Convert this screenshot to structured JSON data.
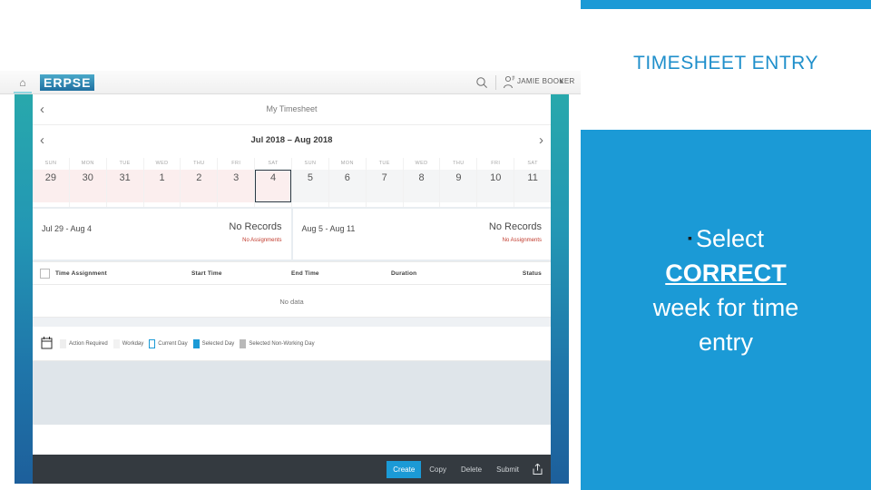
{
  "slide": {
    "title": "TIMESHEET ENTRY",
    "bullet": {
      "marker": "▪",
      "line1": "Select",
      "emphasis": "CORRECT",
      "line2": "week for time",
      "line3": "entry"
    },
    "colors": {
      "accent_blue": "#1b9ad6",
      "title_blue": "#1f8fcb",
      "panel_white": "#ffffff"
    }
  },
  "app": {
    "header": {
      "home_icon": "home-icon",
      "brand": "ERPSE",
      "search_icon": "search-icon",
      "user_icon": "user-icon",
      "user_name": "JAMIE BOOKER",
      "caret": "∨"
    },
    "nav": {
      "back_chevron": "‹",
      "forward_chevron": "›",
      "page_title": "My Timesheet",
      "period": "Jul 2018 – Aug 2018"
    },
    "calendar": {
      "days": [
        {
          "dow": "SUN",
          "num": "29",
          "week": "a",
          "selected": false
        },
        {
          "dow": "MON",
          "num": "30",
          "week": "a",
          "selected": false
        },
        {
          "dow": "TUE",
          "num": "31",
          "week": "a",
          "selected": false
        },
        {
          "dow": "WED",
          "num": "1",
          "week": "a",
          "selected": false
        },
        {
          "dow": "THU",
          "num": "2",
          "week": "a",
          "selected": false
        },
        {
          "dow": "FRI",
          "num": "3",
          "week": "a",
          "selected": false
        },
        {
          "dow": "SAT",
          "num": "4",
          "week": "a",
          "selected": true
        },
        {
          "dow": "SUN",
          "num": "5",
          "week": "b",
          "selected": false
        },
        {
          "dow": "MON",
          "num": "6",
          "week": "b",
          "selected": false
        },
        {
          "dow": "TUE",
          "num": "7",
          "week": "b",
          "selected": false
        },
        {
          "dow": "WED",
          "num": "8",
          "week": "b",
          "selected": false
        },
        {
          "dow": "THU",
          "num": "9",
          "week": "b",
          "selected": false
        },
        {
          "dow": "FRI",
          "num": "10",
          "week": "b",
          "selected": false
        },
        {
          "dow": "SAT",
          "num": "11",
          "week": "b",
          "selected": false
        }
      ]
    },
    "record_cards": [
      {
        "range": "Jul 29 - Aug 4",
        "records": "No Records",
        "assignments": "No Assignments"
      },
      {
        "range": "Aug 5 - Aug 11",
        "records": "No Records",
        "assignments": "No Assignments"
      }
    ],
    "table": {
      "headers": [
        "Time Assignment",
        "Start Time",
        "End Time",
        "Duration",
        "Status"
      ],
      "empty_text": "No data"
    },
    "legend": {
      "icon": "calendar-icon",
      "items": [
        {
          "label": "Action Required",
          "swatch": "sw-action"
        },
        {
          "label": "Workday",
          "swatch": "sw-workday"
        },
        {
          "label": "Current Day",
          "swatch": "sw-current"
        },
        {
          "label": "Selected Day",
          "swatch": "sw-selday"
        },
        {
          "label": "Selected Non-Working Day",
          "swatch": "sw-selnon"
        }
      ]
    },
    "footer": {
      "buttons": [
        {
          "label": "Create",
          "primary": true
        },
        {
          "label": "Copy",
          "primary": false
        },
        {
          "label": "Delete",
          "primary": false
        },
        {
          "label": "Submit",
          "primary": false
        }
      ],
      "share_icon": "share-icon"
    }
  }
}
